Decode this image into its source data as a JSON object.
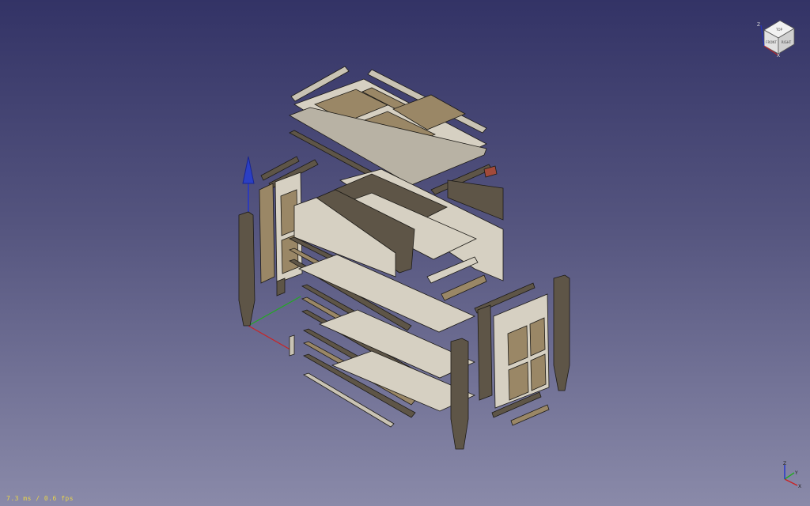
{
  "app": "FreeCAD 3D view",
  "navcube": {
    "faces": {
      "top": "TOP",
      "front": "FRONT",
      "right": "RIGHT"
    },
    "axis_labels": {
      "z": "Z",
      "x": "X"
    }
  },
  "mini_axis": {
    "x": "X",
    "y": "Y",
    "z": "Z"
  },
  "status": {
    "fps": "7.3 ms / 0.6 fps"
  },
  "colors": {
    "bg_top": "#333366",
    "bg_bottom": "#8a8aa9",
    "wood_dark": "#5e5547",
    "wood_light": "#d6d0c2",
    "panel_tan": "#9a8766",
    "axis_x": "#cc2222",
    "axis_y": "#22aa22",
    "axis_z": "#2233cc"
  }
}
